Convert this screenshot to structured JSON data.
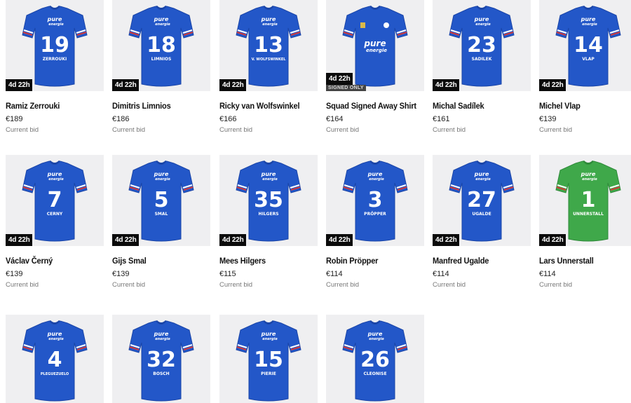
{
  "status_label": "Current bid",
  "signed_badge": "Signed only",
  "colors": {
    "home": "#2357c8",
    "keeper": "#3fa84a",
    "accent": "#d13a3a"
  },
  "lots": [
    {
      "name": "Ramiz Zerrouki",
      "price": "€189",
      "timer": "4d 22h",
      "number": "19",
      "shirt_name": "ZERROUKI",
      "kit": "blue"
    },
    {
      "name": "Dimitris Limnios",
      "price": "€186",
      "timer": "4d 22h",
      "number": "18",
      "shirt_name": "LIMNIOS",
      "kit": "blue"
    },
    {
      "name": "Ricky van Wolfswinkel",
      "price": "€166",
      "timer": "4d 22h",
      "number": "13",
      "shirt_name": "V. WOLFSWINKEL",
      "kit": "blue"
    },
    {
      "name": "Squad Signed Away Shirt",
      "price": "€164",
      "timer": "4d 22h",
      "number": "",
      "shirt_name": "",
      "kit": "front",
      "signed": true
    },
    {
      "name": "Michal Sadílek",
      "price": "€161",
      "timer": "4d 22h",
      "number": "23",
      "shirt_name": "SADILEK",
      "kit": "blue"
    },
    {
      "name": "Michel Vlap",
      "price": "€139",
      "timer": "4d 22h",
      "number": "14",
      "shirt_name": "VLAP",
      "kit": "blue"
    },
    {
      "name": "Václav Černý",
      "price": "€139",
      "timer": "4d 22h",
      "number": "7",
      "shirt_name": "CERNY",
      "kit": "blue"
    },
    {
      "name": "Gijs Smal",
      "price": "€139",
      "timer": "4d 22h",
      "number": "5",
      "shirt_name": "SMAL",
      "kit": "blue"
    },
    {
      "name": "Mees Hilgers",
      "price": "€115",
      "timer": "4d 22h",
      "number": "35",
      "shirt_name": "HILGERS",
      "kit": "blue"
    },
    {
      "name": "Robin Pröpper",
      "price": "€114",
      "timer": "4d 22h",
      "number": "3",
      "shirt_name": "PRÖPPER",
      "kit": "blue"
    },
    {
      "name": "Manfred Ugalde",
      "price": "€114",
      "timer": "4d 22h",
      "number": "27",
      "shirt_name": "UGALDE",
      "kit": "blue"
    },
    {
      "name": "Lars Unnerstall",
      "price": "€114",
      "timer": "4d 22h",
      "number": "1",
      "shirt_name": "UNNERSTALL",
      "kit": "green"
    },
    {
      "name": "",
      "price": "",
      "timer": "",
      "number": "4",
      "shirt_name": "PLEGUEZUELO",
      "kit": "blue"
    },
    {
      "name": "",
      "price": "",
      "timer": "",
      "number": "32",
      "shirt_name": "BOSCH",
      "kit": "blue"
    },
    {
      "name": "",
      "price": "",
      "timer": "",
      "number": "15",
      "shirt_name": "PIERIE",
      "kit": "blue"
    },
    {
      "name": "",
      "price": "",
      "timer": "",
      "number": "26",
      "shirt_name": "CLEONISE",
      "kit": "blue"
    }
  ],
  "sponsor": {
    "line1": "pure",
    "line2": "energie"
  }
}
